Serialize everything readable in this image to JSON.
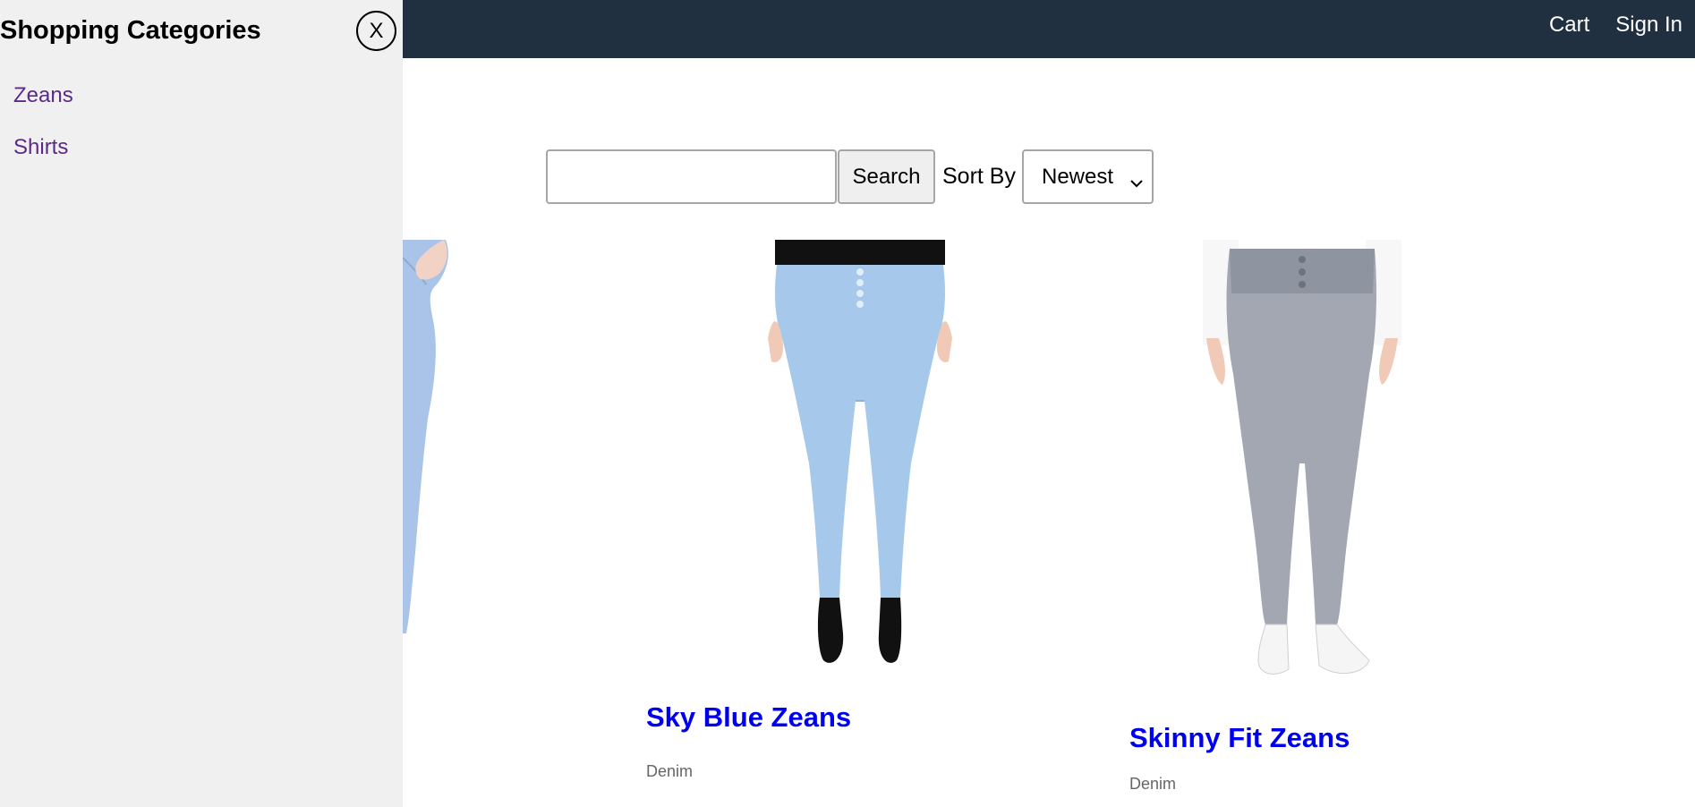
{
  "header": {
    "cart_label": "Cart",
    "signin_label": "Sign In"
  },
  "sidebar": {
    "title": "Shopping Categories",
    "close_label": "X",
    "categories": [
      {
        "label": "Zeans"
      },
      {
        "label": "Shirts"
      }
    ]
  },
  "search": {
    "value": "",
    "button_label": "Search",
    "sort_label": "Sort By",
    "sort_selected": "Newest"
  },
  "products": [
    {
      "title": "",
      "brand": ""
    },
    {
      "title": "Sky Blue Zeans",
      "brand": "Denim",
      "image": "sky-blue-jeans-photo"
    },
    {
      "title": "Skinny Fit Zeans",
      "brand": "Denim",
      "image": "grey-skinny-jeans-photo"
    }
  ],
  "colors": {
    "header_bg": "#203040",
    "sidebar_bg": "#f0f0f0",
    "link_blue": "#0000ee",
    "category_purple": "#5b2a86"
  }
}
